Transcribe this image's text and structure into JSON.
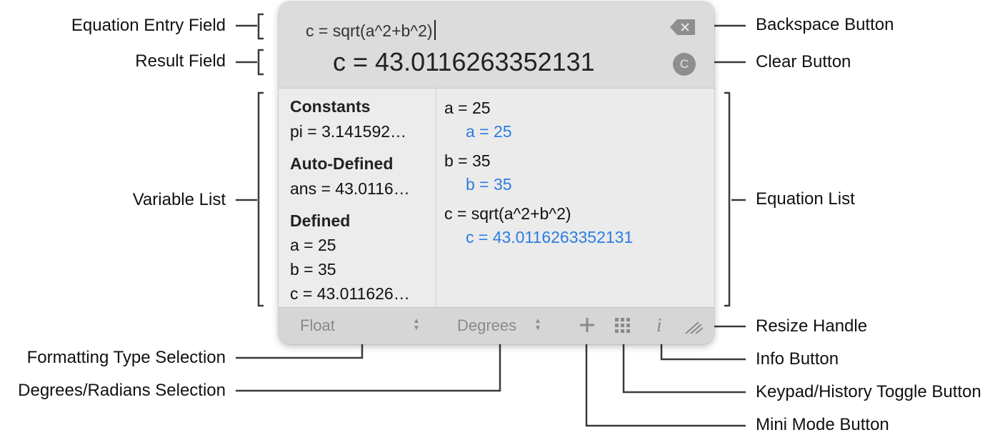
{
  "callouts": {
    "equation_entry_field": "Equation Entry Field",
    "result_field": "Result Field",
    "variable_list": "Variable List",
    "formatting_type_selection": "Formatting Type Selection",
    "degrees_radians_selection": "Degrees/Radians Selection",
    "backspace_button": "Backspace Button",
    "clear_button": "Clear Button",
    "equation_list": "Equation List",
    "resize_handle": "Resize Handle",
    "info_button": "Info Button",
    "keypad_history_toggle_button": "Keypad/History Toggle Button",
    "mini_mode_button": "Mini Mode Button"
  },
  "calculator": {
    "entry": "c = sqrt(a^2+b^2)",
    "result": "c = 43.0116263352131",
    "clear_icon": "C",
    "variables": {
      "constants_heading": "Constants",
      "pi": "pi = 3.141592…",
      "auto_heading": "Auto-Defined",
      "ans": "ans = 43.0116…",
      "defined_heading": "Defined",
      "a": "a = 25",
      "b": "b = 35",
      "c": "c = 43.011626…"
    },
    "equations": [
      {
        "input": "a = 25",
        "output": "a = 25"
      },
      {
        "input": "b = 35",
        "output": "b = 35"
      },
      {
        "input": "c = sqrt(a^2+b^2)",
        "output": "c = 43.0116263352131"
      }
    ],
    "format_select": "Float",
    "angle_select": "Degrees",
    "info_icon": "i",
    "colors": {
      "result_blue": "#2b7de1",
      "window_bg": "#ebebeb",
      "header_bg": "#dcdcdc"
    }
  }
}
